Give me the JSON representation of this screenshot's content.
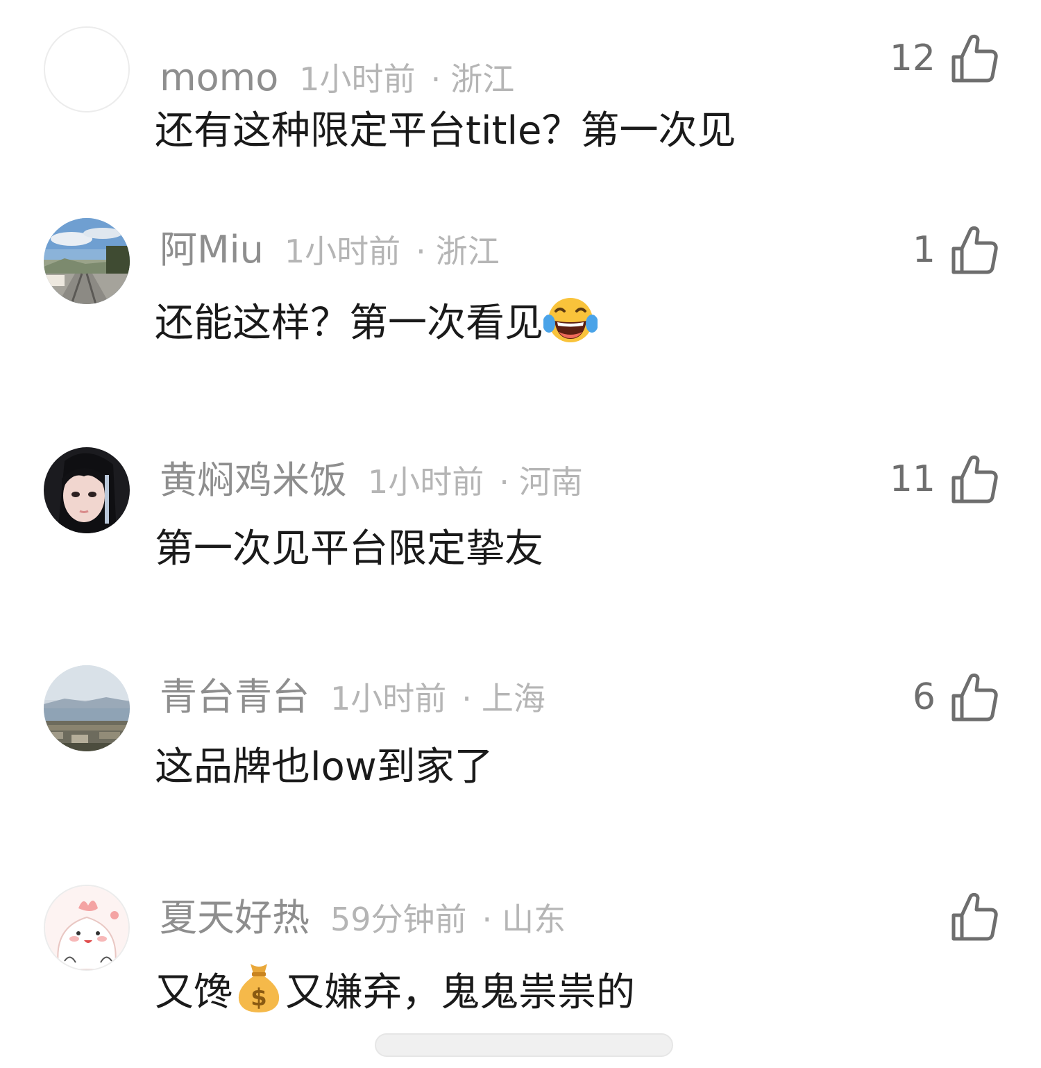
{
  "comments": [
    {
      "username": "momo",
      "time": "1小时前",
      "location": "浙江",
      "text": "还有这种限定平台title？第一次见",
      "likes": "12",
      "avatar": "blank-circle"
    },
    {
      "username": "阿Miu",
      "time": "1小时前",
      "location": "浙江",
      "text": "还能这样？第一次看见",
      "emoji": "tears-of-joy-emoji",
      "likes": "1",
      "avatar": "railway-landscape-photo"
    },
    {
      "username": "黄焖鸡米饭",
      "time": "1小时前",
      "location": "河南",
      "text": "第一次见平台限定挚友",
      "likes": "11",
      "avatar": "portrait-photo"
    },
    {
      "username": "青台青台",
      "time": "1小时前",
      "location": "上海",
      "text": "这品牌也low到家了",
      "likes": "6",
      "avatar": "lake-cityscape-photo"
    },
    {
      "username": "夏天好热",
      "time": "59分钟前",
      "location": "山东",
      "text_part1": "又馋",
      "text_part2": "又嫌弃，鬼鬼祟祟的",
      "emoji": "money-bag-emoji",
      "likes": "",
      "avatar": "cartoon-character"
    }
  ],
  "separator": "·",
  "colors": {
    "username": "#8e8e8e",
    "meta": "#b5b5b5",
    "text": "#1a1a1a",
    "like_icon": "#6e6e6e"
  }
}
